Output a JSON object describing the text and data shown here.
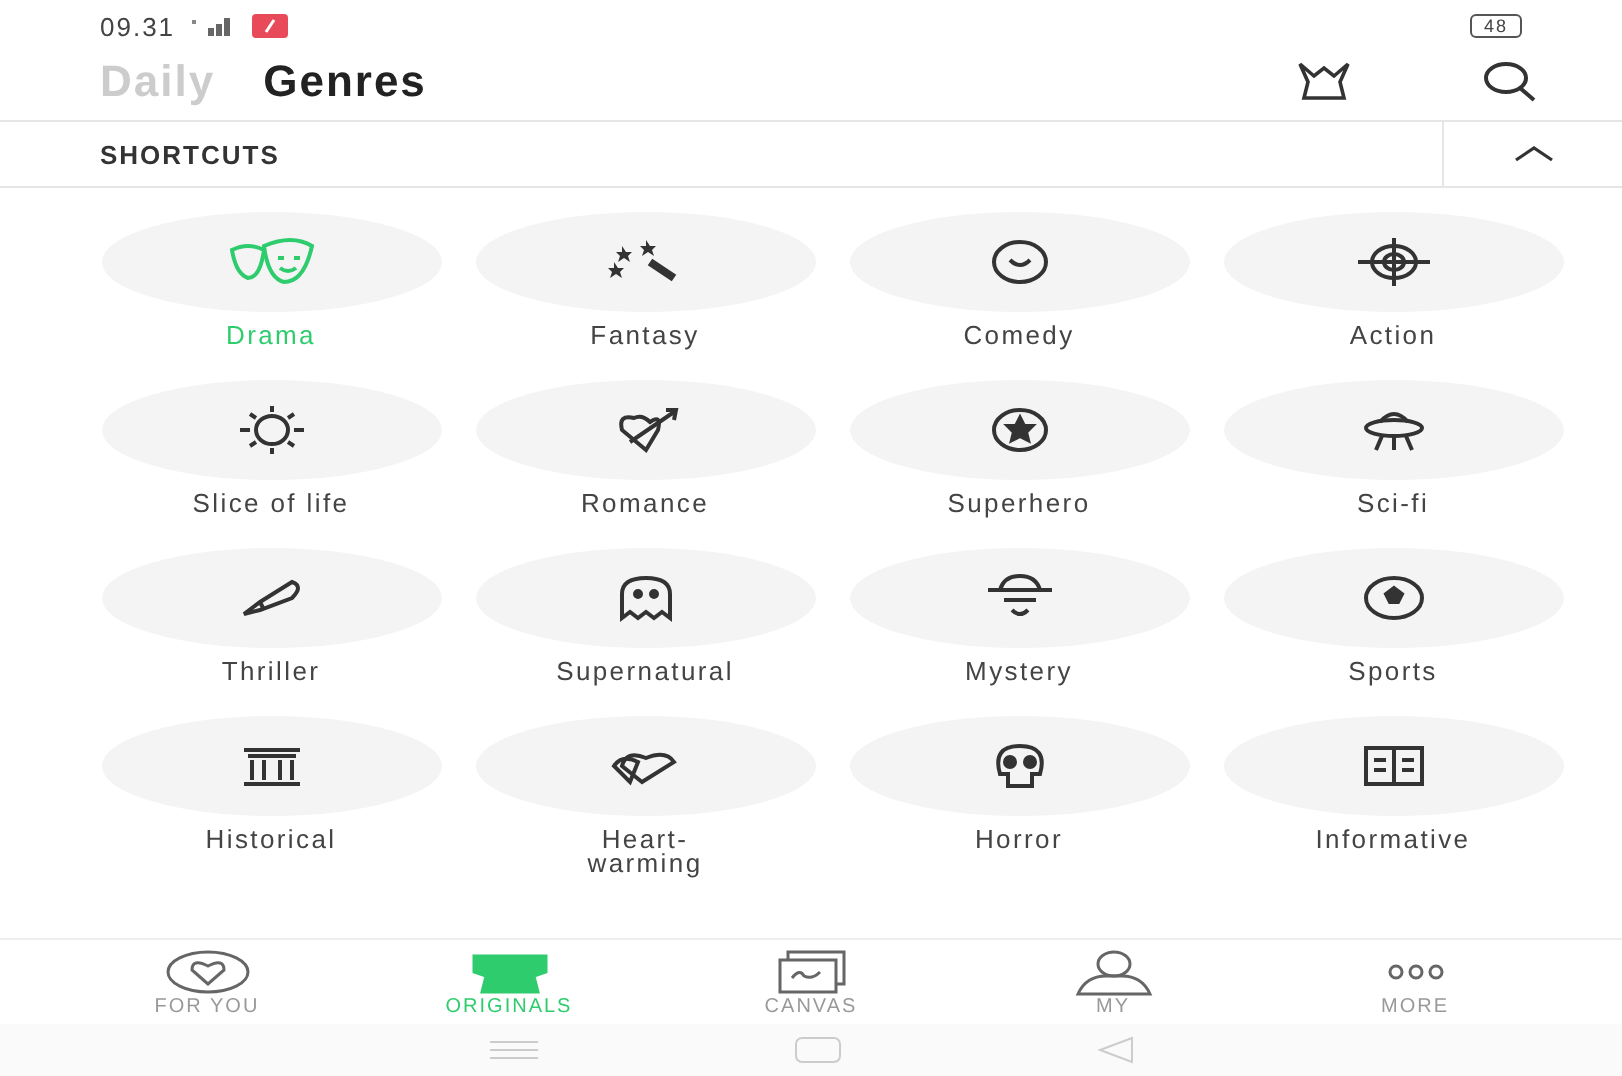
{
  "status_bar": {
    "time": "09.31",
    "battery": "48"
  },
  "tabs": [
    {
      "label": "Daily",
      "selected": false
    },
    {
      "label": "Genres",
      "selected": true
    }
  ],
  "shortcuts": {
    "title": "SHORTCUTS",
    "expanded": true
  },
  "genres": [
    {
      "label": "Drama",
      "selected": true
    },
    {
      "label": "Fantasy",
      "selected": false
    },
    {
      "label": "Comedy",
      "selected": false
    },
    {
      "label": "Action",
      "selected": false
    },
    {
      "label": "Slice of life",
      "selected": false
    },
    {
      "label": "Romance",
      "selected": false
    },
    {
      "label": "Superhero",
      "selected": false
    },
    {
      "label": "Sci-fi",
      "selected": false
    },
    {
      "label": "Thriller",
      "selected": false
    },
    {
      "label": "Supernatural",
      "selected": false
    },
    {
      "label": "Mystery",
      "selected": false
    },
    {
      "label": "Sports",
      "selected": false
    },
    {
      "label": "Historical",
      "selected": false
    },
    {
      "label": "Heart-\nwarming",
      "selected": false
    },
    {
      "label": "Horror",
      "selected": false
    },
    {
      "label": "Informative",
      "selected": false
    }
  ],
  "bottom_nav": [
    {
      "label": "FOR YOU",
      "selected": false
    },
    {
      "label": "ORIGINALS",
      "selected": true
    },
    {
      "label": "CANVAS",
      "selected": false
    },
    {
      "label": "MY",
      "selected": false
    },
    {
      "label": "MORE",
      "selected": false
    }
  ]
}
